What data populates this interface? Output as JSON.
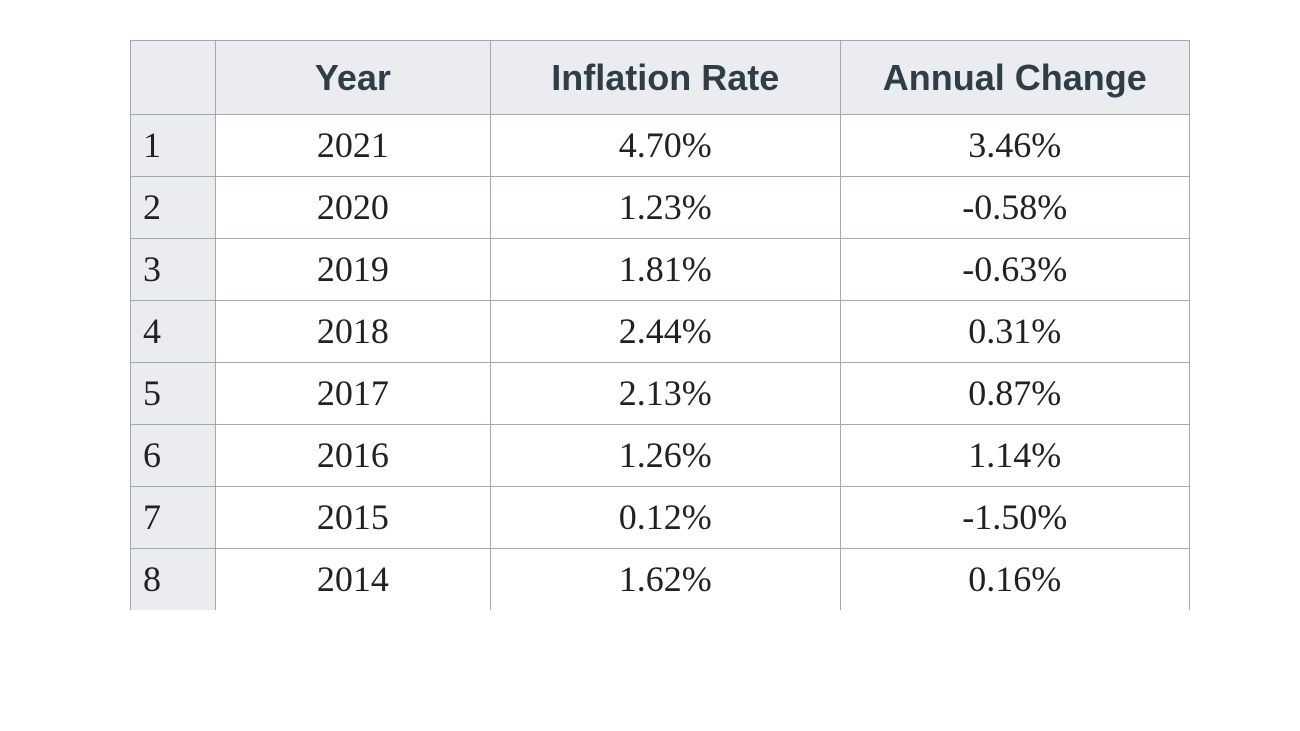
{
  "headers": {
    "index": "",
    "year": "Year",
    "rate": "Inflation Rate",
    "change": "Annual Change"
  },
  "rows": [
    {
      "n": "1",
      "year": "2021",
      "rate": "4.70%",
      "change": "3.46%"
    },
    {
      "n": "2",
      "year": "2020",
      "rate": "1.23%",
      "change": "-0.58%"
    },
    {
      "n": "3",
      "year": "2019",
      "rate": "1.81%",
      "change": "-0.63%"
    },
    {
      "n": "4",
      "year": "2018",
      "rate": "2.44%",
      "change": "0.31%"
    },
    {
      "n": "5",
      "year": "2017",
      "rate": "2.13%",
      "change": "0.87%"
    },
    {
      "n": "6",
      "year": "2016",
      "rate": "1.26%",
      "change": "1.14%"
    },
    {
      "n": "7",
      "year": "2015",
      "rate": "0.12%",
      "change": "-1.50%"
    },
    {
      "n": "8",
      "year": "2014",
      "rate": "1.62%",
      "change": "0.16%"
    }
  ],
  "chart_data": {
    "type": "table",
    "columns": [
      "Year",
      "Inflation Rate",
      "Annual Change"
    ],
    "rows": [
      [
        "2021",
        "4.70%",
        "3.46%"
      ],
      [
        "2020",
        "1.23%",
        "-0.58%"
      ],
      [
        "2019",
        "1.81%",
        "-0.63%"
      ],
      [
        "2018",
        "2.44%",
        "0.31%"
      ],
      [
        "2017",
        "2.13%",
        "0.87%"
      ],
      [
        "2016",
        "1.26%",
        "1.14%"
      ],
      [
        "2015",
        "0.12%",
        "-1.50%"
      ],
      [
        "2014",
        "1.62%",
        "0.16%"
      ]
    ]
  }
}
